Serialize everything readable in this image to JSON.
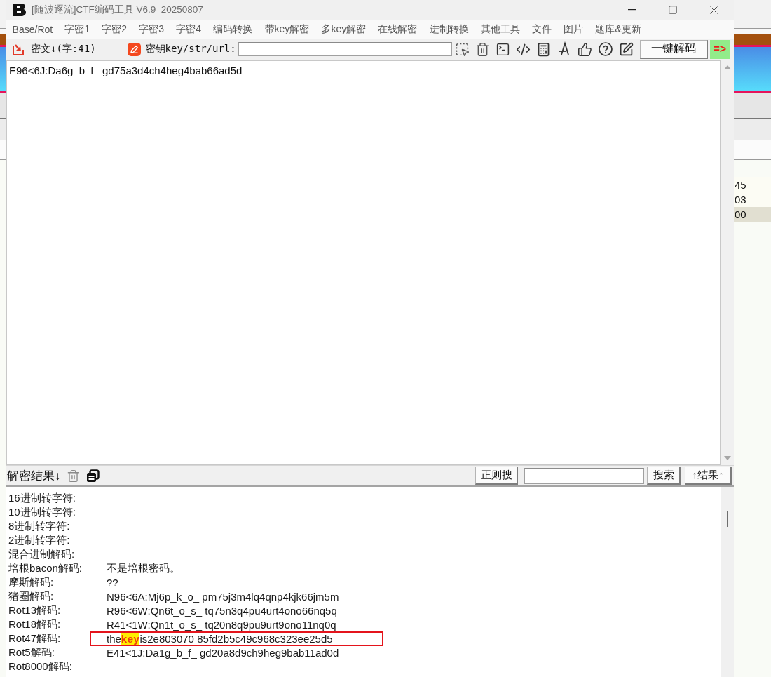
{
  "window": {
    "title": "[随波逐流]CTF编码工具 V6.9  20250807"
  },
  "menu": [
    "Base/Rot",
    "字密1",
    "字密2",
    "字密3",
    "字密4",
    "编码转换",
    "带key解密",
    "多key解密",
    "在线解密",
    "进制转换",
    "其他工具",
    "文件",
    "图片",
    "题库&更新"
  ],
  "toolbar": {
    "ciphertext_label": "密文↓(字:41)",
    "key_label": "密钥key/str/url:",
    "decode_button": "一键解码",
    "indicator": "=>"
  },
  "input_text": "E96<6J:Da6g_b_f_ gd75a3d4ch4heg4bab66ad5d",
  "results_bar": {
    "title": "解密结果↓",
    "regex_button": "正则搜",
    "search_button": "搜索",
    "results_button": "↑结果↑"
  },
  "results": [
    {
      "label": "16进制转字符:",
      "boxed": false
    },
    {
      "label": "10进制转字符:",
      "boxed": false
    },
    {
      "label": "8进制转字符:",
      "boxed": false
    },
    {
      "label": "2进制转字符:",
      "boxed": false
    },
    {
      "label": "混合进制解码:",
      "boxed": false
    },
    {
      "label": "培根bacon解码:",
      "value": "不是培根密码。",
      "boxed": false
    },
    {
      "label": "摩斯解码:",
      "value": "??",
      "boxed": false
    },
    {
      "label": "猪圈解码:",
      "value": "N96<6A:Mj6p_k_o_ pm75j3m4lq4qnp4kjk66jm5m",
      "boxed": false
    },
    {
      "label": "Rot13解码:",
      "value": "R96<6W:Qn6t_o_s_ tq75n3q4pu4urt4ono66nq5q",
      "boxed": false
    },
    {
      "label": "Rot18解码:",
      "value": "R41<1W:Qn1t_o_s_ tq20n8q9pu9urt9ono11nq0q",
      "boxed": false
    },
    {
      "label": "Rot47解码:",
      "value": "the**key**is2e803070 85fd2b5c49c968c323ee25d5",
      "boxed": true
    },
    {
      "label": "Rot5解码:",
      "value": "E41<1J:Da1g_b_f_ gd20a8d9ch9heg9bab11ad0d",
      "boxed": false
    },
    {
      "label": "Rot8000解码:",
      "boxed": false
    }
  ],
  "background_window": {
    "cells": [
      {
        "text": "45",
        "selected": false
      },
      {
        "text": "03",
        "selected": false
      },
      {
        "text": "00",
        "selected": true
      }
    ]
  }
}
